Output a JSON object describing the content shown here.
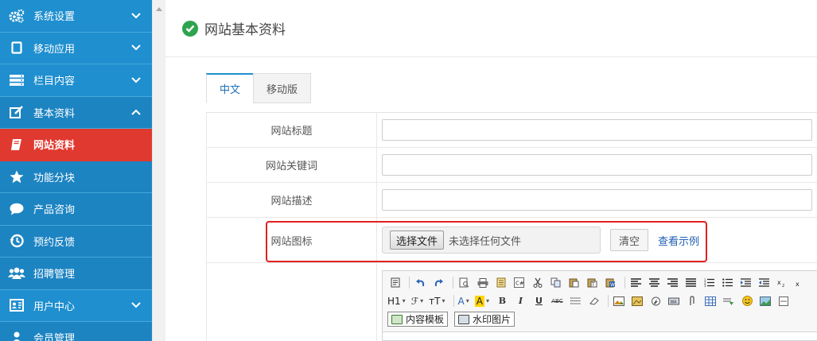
{
  "sidebar": {
    "items": [
      {
        "label": "系统设置",
        "icon": "gears-icon",
        "chevron": "down"
      },
      {
        "label": "移动应用",
        "icon": "tablet-icon",
        "chevron": "down"
      },
      {
        "label": "栏目内容",
        "icon": "list-icon",
        "chevron": "down"
      },
      {
        "label": "基本资料",
        "icon": "edit-icon",
        "chevron": "up"
      },
      {
        "label": "网站资料",
        "icon": "book-icon",
        "active": true
      },
      {
        "label": "功能分块",
        "icon": "star-icon"
      },
      {
        "label": "产品咨询",
        "icon": "comment-icon"
      },
      {
        "label": "预约反馈",
        "icon": "history-icon"
      },
      {
        "label": "招聘管理",
        "icon": "users-icon"
      },
      {
        "label": "用户中心",
        "icon": "id-card-icon",
        "chevron": "down"
      },
      {
        "label": "会员管理",
        "icon": "user-icon"
      }
    ]
  },
  "header": {
    "title": "网站基本资料"
  },
  "tabs": [
    {
      "label": "中文",
      "active": true
    },
    {
      "label": "移动版",
      "active": false
    }
  ],
  "form": {
    "site_title_label": "网站标题",
    "site_title_value": "",
    "keywords_label": "网站关键词",
    "keywords_value": "",
    "description_label": "网站描述",
    "description_value": "",
    "icon_label": "网站图标",
    "file_button": "选择文件",
    "file_status": "未选择任何文件",
    "clear_button": "清空",
    "view_example": "查看示例"
  },
  "editor": {
    "h1_label": "H1",
    "font_label": "ℱ",
    "size_label": "тT",
    "font_color_label": "A",
    "highlight_label": "A",
    "content_template": "内容模板",
    "watermark_image": "水印图片"
  },
  "colors": {
    "sidebar_bg": "#1f8fcf",
    "sidebar_active": "#e0392f",
    "highlight_border": "#e02020",
    "check_green": "#2ea44f"
  }
}
